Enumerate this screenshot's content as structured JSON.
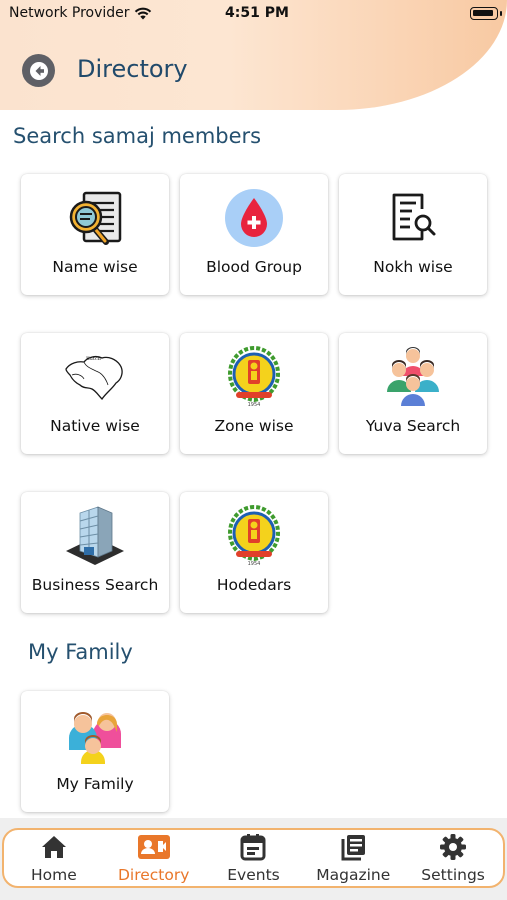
{
  "status_bar": {
    "carrier": "Network Provider",
    "time": "4:51 PM"
  },
  "header": {
    "title": "Directory",
    "back_icon": "back-arrow-icon"
  },
  "search_section": {
    "title": "Search samaj members",
    "tiles": [
      {
        "label": "Name wise",
        "icon": "document-search-icon"
      },
      {
        "label": "Blood Group",
        "icon": "blood-drop-icon"
      },
      {
        "label": "Nokh wise",
        "icon": "list-search-icon"
      },
      {
        "label": "Native wise",
        "icon": "map-outline-icon"
      },
      {
        "label": "Zone wise",
        "icon": "samaj-emblem-icon"
      },
      {
        "label": "Yuva Search",
        "icon": "youth-group-icon"
      },
      {
        "label": "Business Search",
        "icon": "building-icon"
      },
      {
        "label": "Hodedars",
        "icon": "samaj-emblem-icon"
      }
    ]
  },
  "family_section": {
    "title": "My Family",
    "tiles": [
      {
        "label": "My Family",
        "icon": "family-icon"
      }
    ]
  },
  "bottom_nav": {
    "active": "Directory",
    "accent": "#e9772a",
    "items": [
      {
        "label": "Home",
        "icon": "home-icon"
      },
      {
        "label": "Directory",
        "icon": "contact-card-icon"
      },
      {
        "label": "Events",
        "icon": "calendar-icon"
      },
      {
        "label": "Magazine",
        "icon": "magazine-icon"
      },
      {
        "label": "Settings",
        "icon": "gear-icon"
      }
    ]
  }
}
